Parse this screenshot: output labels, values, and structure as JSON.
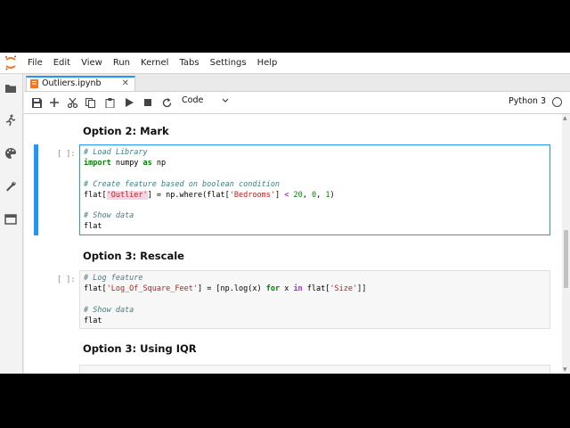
{
  "menu": [
    "File",
    "Edit",
    "View",
    "Run",
    "Kernel",
    "Tabs",
    "Settings",
    "Help"
  ],
  "tab": {
    "title": "Outliers.ipynb",
    "close": "✕"
  },
  "toolbar": {
    "cell_type": "Code",
    "kernel": "Python 3"
  },
  "sidebar_icons": [
    "folder-icon",
    "running-icon",
    "palette-icon",
    "wrench-icon",
    "tabs-icon"
  ],
  "cells": {
    "h_mark": "Option 2: Mark",
    "c1_prompt": "[ ]:",
    "c1_l1": "# Load Library",
    "c1_l2_kw": "import",
    "c1_l2_mod": " numpy ",
    "c1_l2_as": "as",
    "c1_l2_alias": " np",
    "c1_l4": "# Create feature based on boolean condition",
    "c1_l5_a": "flat[",
    "c1_l5_b": "'Outlier'",
    "c1_l5_c": "] = np.where(flat[",
    "c1_l5_d": "'Bedrooms'",
    "c1_l5_e": "] ",
    "c1_l5_f": "<",
    "c1_l5_g": " ",
    "c1_l5_h": "20",
    "c1_l5_i": ", ",
    "c1_l5_j": "0",
    "c1_l5_k": ", ",
    "c1_l5_l": "1",
    "c1_l5_m": ")",
    "c1_l7": "# Show data",
    "c1_l8": "flat",
    "h_rescale": "Option 3: Rescale",
    "c2_prompt": "[ ]:",
    "c2_l1": "# Log feature",
    "c2_l2_a": "flat[",
    "c2_l2_b": "'Log_Of_Square_Feet'",
    "c2_l2_c": "] = [np.log(x) ",
    "c2_l2_for": "for",
    "c2_l2_d": " x ",
    "c2_l2_in": "in",
    "c2_l2_e": " flat[",
    "c2_l2_f": "'Size'",
    "c2_l2_g": "]]",
    "c2_l4": "# Show data",
    "c2_l5": "flat",
    "h_iqr": "Option 3: Using IQR"
  },
  "colors": {
    "accent": "#2196f3",
    "comment": "#408080",
    "keyword": "#008000",
    "string": "#ba2121",
    "jupyter": "#f37626"
  }
}
